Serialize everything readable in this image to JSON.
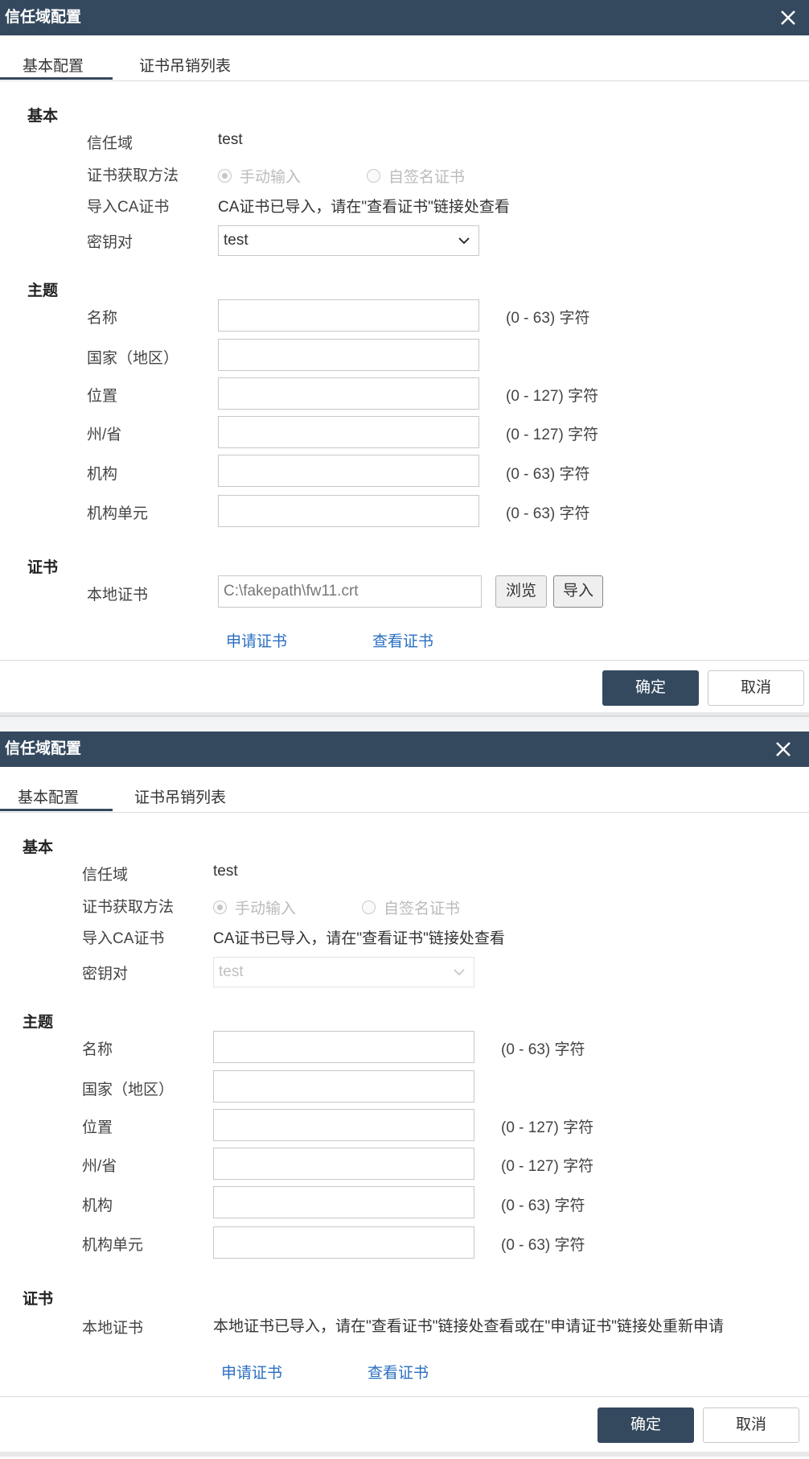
{
  "dialog1": {
    "title": "信任域配置",
    "tabs": [
      "基本配置",
      "证书吊销列表"
    ],
    "sections": {
      "basic": "基本",
      "subject": "主题",
      "cert": "证书"
    },
    "labels": {
      "trust_domain": "信任域",
      "acquire_method": "证书获取方法",
      "import_ca": "导入CA证书",
      "key_pair": "密钥对",
      "name": "名称",
      "country": "国家（地区）",
      "location": "位置",
      "state": "州/省",
      "org": "机构",
      "org_unit": "机构单元",
      "local_cert": "本地证书"
    },
    "trust_domain_value": "test",
    "radio_manual": "手动输入",
    "radio_selfsigned": "自签名证书",
    "ca_status": "CA证书已导入，请在\"查看证书\"链接处查看",
    "key_pair_value": "test",
    "hints": {
      "name": "(0 - 63) 字符",
      "location": "(0 - 127) 字符",
      "state": "(0 - 127) 字符",
      "org": "(0 - 63) 字符",
      "org_unit": "(0 - 63) 字符"
    },
    "local_cert_value": "C:\\fakepath\\fw11.crt",
    "browse": "浏览",
    "import": "导入",
    "apply_cert": "申请证书",
    "view_cert": "查看证书",
    "ok": "确定",
    "cancel": "取消"
  },
  "dialog2": {
    "title": "信任域配置",
    "tabs": [
      "基本配置",
      "证书吊销列表"
    ],
    "sections": {
      "basic": "基本",
      "subject": "主题",
      "cert": "证书"
    },
    "labels": {
      "trust_domain": "信任域",
      "acquire_method": "证书获取方法",
      "import_ca": "导入CA证书",
      "key_pair": "密钥对",
      "name": "名称",
      "country": "国家（地区）",
      "location": "位置",
      "state": "州/省",
      "org": "机构",
      "org_unit": "机构单元",
      "local_cert": "本地证书"
    },
    "trust_domain_value": "test",
    "radio_manual": "手动输入",
    "radio_selfsigned": "自签名证书",
    "ca_status": "CA证书已导入，请在\"查看证书\"链接处查看",
    "key_pair_value": "test",
    "hints": {
      "name": "(0 - 63) 字符",
      "location": "(0 - 127) 字符",
      "state": "(0 - 127) 字符",
      "org": "(0 - 63) 字符",
      "org_unit": "(0 - 63) 字符"
    },
    "local_cert_status": "本地证书已导入，请在\"查看证书\"链接处查看或在\"申请证书\"链接处重新申请",
    "apply_cert": "申请证书",
    "view_cert": "查看证书",
    "ok": "确定",
    "cancel": "取消"
  },
  "colors": {
    "titlebar": "#34495e",
    "link": "#2a6fc0",
    "primary_button": "#34495e"
  },
  "icons": {
    "close": "close-icon",
    "dropdown": "chevron-down-icon"
  }
}
